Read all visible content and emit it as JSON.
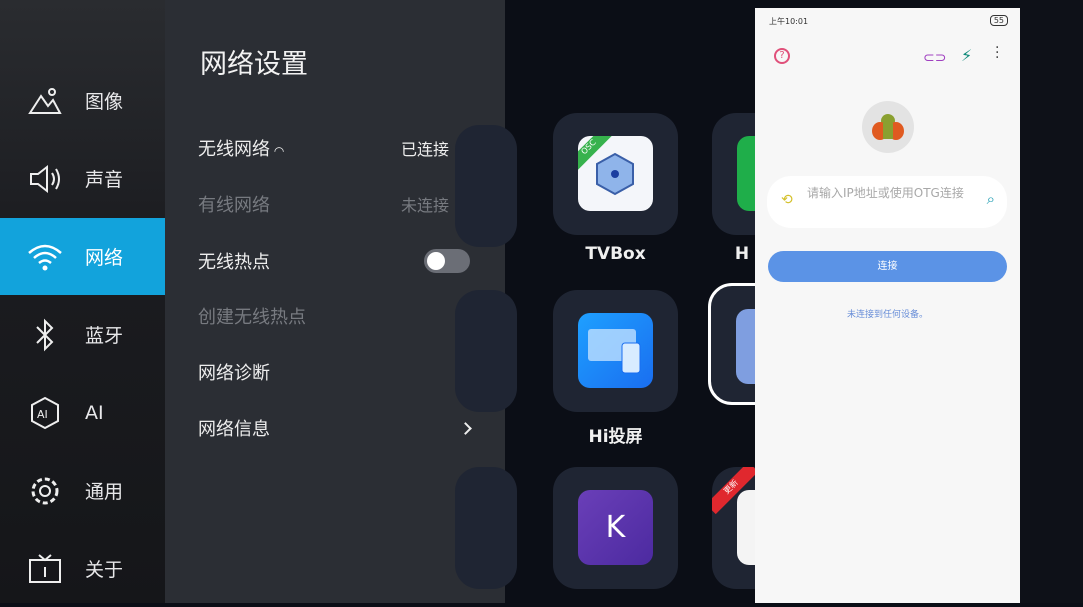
{
  "sidebar": {
    "items": [
      {
        "label": "图像",
        "icon": "image-icon"
      },
      {
        "label": "声音",
        "icon": "speaker-icon"
      },
      {
        "label": "网络",
        "icon": "wifi-icon",
        "active": true
      },
      {
        "label": "蓝牙",
        "icon": "bluetooth-icon"
      },
      {
        "label": "AI",
        "icon": "ai-icon"
      },
      {
        "label": "通用",
        "icon": "gear-icon"
      },
      {
        "label": "关于",
        "icon": "info-tv-icon"
      }
    ]
  },
  "panel": {
    "title": "网络设置",
    "rows": [
      {
        "label": "无线网络",
        "value": "已连接"
      },
      {
        "label": "有线网络",
        "value": "未连接"
      },
      {
        "label": "无线热点",
        "toggle": false
      },
      {
        "label": "创建无线热点",
        "value": ""
      },
      {
        "label": "网络诊断",
        "value": ""
      },
      {
        "label": "网络信息",
        "value": ""
      }
    ]
  },
  "apps": {
    "tvbox": "TVBox",
    "tvbox_badge": "OSC",
    "hi": "Hi投屏",
    "partial": "H",
    "update_badge": "更新"
  },
  "phone": {
    "time": "上午10:01",
    "battery": "55",
    "input_placeholder": "请输入IP地址或使用OTG连接",
    "connect": "连接",
    "status_text": "未连接到任何设备。",
    "colors": {
      "button": "#5b93e6",
      "link": "#6a8fd8"
    }
  }
}
